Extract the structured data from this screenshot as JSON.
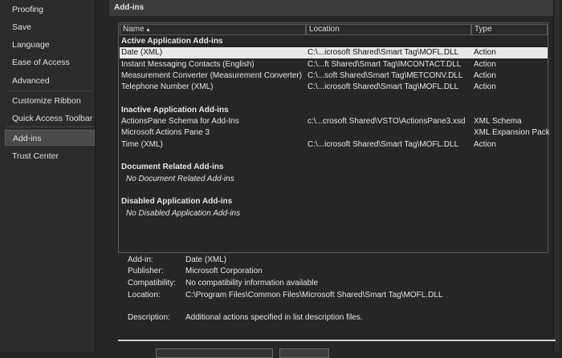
{
  "sidebar": {
    "items": [
      "Proofing",
      "Save",
      "Language",
      "Ease of Access",
      "Advanced",
      "Customize Ribbon",
      "Quick Access Toolbar",
      "Add-ins",
      "Trust Center"
    ],
    "selected": "Add-ins"
  },
  "header": {
    "title": "Add-ins"
  },
  "list": {
    "columns": {
      "name": "Name",
      "sort_icon": "▴",
      "location": "Location",
      "type": "Type"
    },
    "rows": [
      {
        "kind": "group",
        "name": "Active Application Add-ins"
      },
      {
        "kind": "item",
        "name": "Date (XML)",
        "location": "C:\\...icrosoft Shared\\Smart Tag\\MOFL.DLL",
        "type": "Action",
        "selected": true
      },
      {
        "kind": "item",
        "name": "Instant Messaging Contacts (English)",
        "location": "C:\\...ft Shared\\Smart Tag\\IMCONTACT.DLL",
        "type": "Action"
      },
      {
        "kind": "item",
        "name": "Measurement Converter (Measurement Converter)",
        "location": "C:\\...soft Shared\\Smart Tag\\METCONV.DLL",
        "type": "Action"
      },
      {
        "kind": "item",
        "name": "Telephone Number (XML)",
        "location": "C:\\...icrosoft Shared\\Smart Tag\\MOFL.DLL",
        "type": "Action"
      },
      {
        "kind": "blank"
      },
      {
        "kind": "group",
        "name": "Inactive Application Add-ins"
      },
      {
        "kind": "item",
        "name": "ActionsPane Schema for Add-Ins",
        "location": "c:\\...crosoft Shared\\VSTO\\ActionsPane3.xsd",
        "type": "XML Schema"
      },
      {
        "kind": "item",
        "name": "Microsoft Actions Pane 3",
        "location": "",
        "type": "XML Expansion Pack"
      },
      {
        "kind": "item",
        "name": "Time (XML)",
        "location": "C:\\...icrosoft Shared\\Smart Tag\\MOFL.DLL",
        "type": "Action"
      },
      {
        "kind": "blank"
      },
      {
        "kind": "group",
        "name": "Document Related Add-ins"
      },
      {
        "kind": "empty",
        "name": "No Document Related Add-ins"
      },
      {
        "kind": "blank"
      },
      {
        "kind": "group",
        "name": "Disabled Application Add-ins"
      },
      {
        "kind": "empty",
        "name": "No Disabled Application Add-ins"
      }
    ]
  },
  "details": [
    {
      "label": "Add-in:",
      "value": "Date (XML)"
    },
    {
      "label": "Publisher:",
      "value": "Microsoft Corporation"
    },
    {
      "label": "Compatibility:",
      "value": "No compatibility information available"
    },
    {
      "label": "Location:",
      "value": "C:\\Program Files\\Common Files\\Microsoft Shared\\Smart Tag\\MOFL.DLL"
    },
    {
      "label": "Description:",
      "value": "Additional actions specified in list description files."
    }
  ]
}
